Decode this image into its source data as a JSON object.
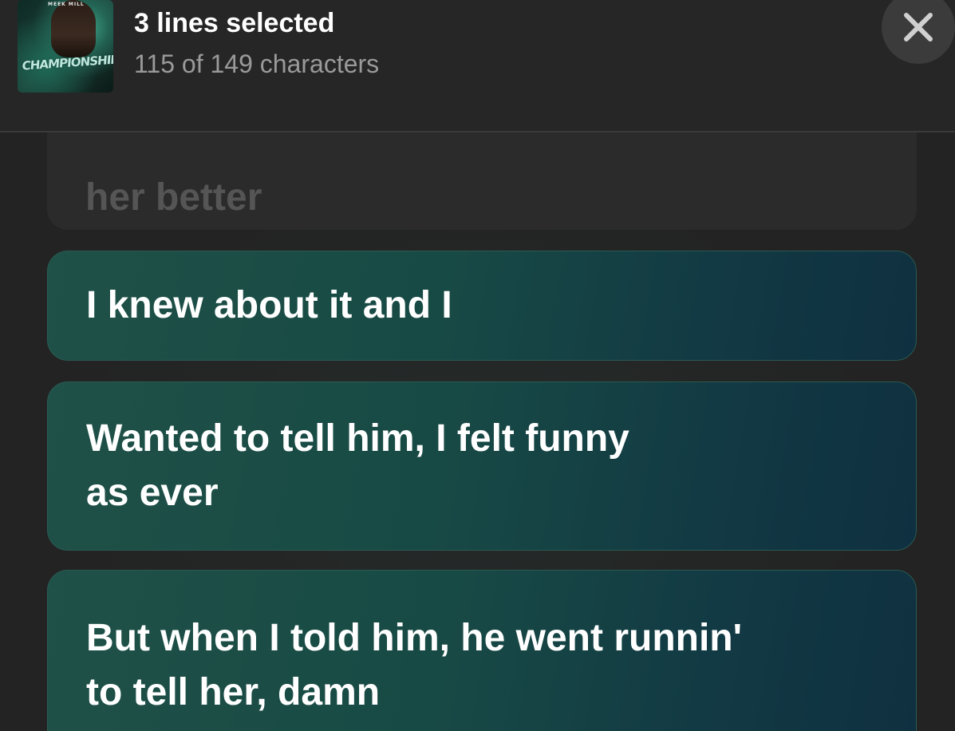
{
  "header": {
    "title": "3 lines selected",
    "subtitle": "115 of 149 characters",
    "album_artist_text": "MEEK MILL",
    "album_title_text": "CHAMPIONSHIPS",
    "close_icon": "close-icon"
  },
  "lyrics": {
    "previous_line": "her better",
    "selected": [
      {
        "text": "I knew about it and I"
      },
      {
        "text": "Wanted to tell him, I felt funny\nas ever"
      },
      {
        "text": "But when I told him, he went runnin'\nto tell her, damn"
      }
    ]
  },
  "colors": {
    "background": "#232323",
    "header_bg": "#262626",
    "selected_card_start": "#1f5148",
    "selected_card_end": "#0f3040",
    "subtitle": "#9a9a9a"
  }
}
